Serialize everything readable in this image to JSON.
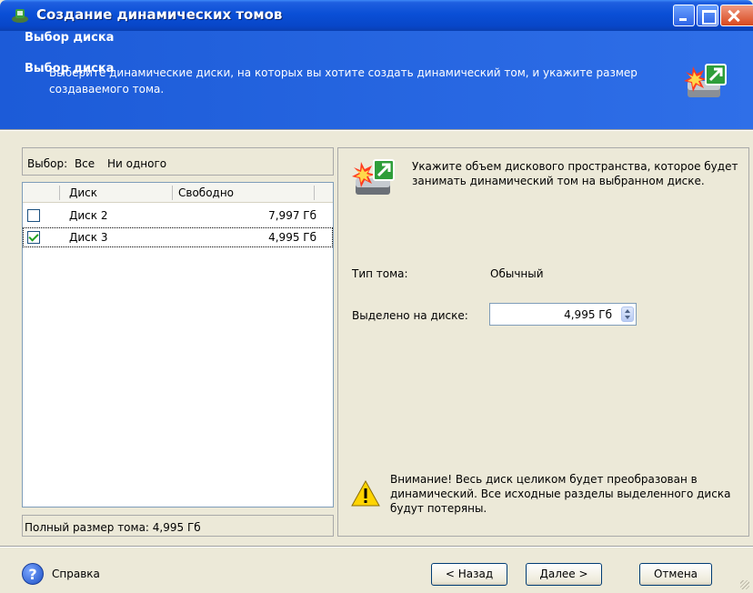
{
  "window": {
    "title": "Создание динамических томов"
  },
  "header": {
    "title": "Выбор диска",
    "description": "Выберите динамические диски, на которых вы хотите создать динамический том, и укажите размер создаваемого тома."
  },
  "selection_bar": {
    "label": "Выбор:",
    "all": "Все",
    "none": "Ни одного"
  },
  "disk_list": {
    "columns": [
      "Диск",
      "Свободно"
    ],
    "rows": [
      {
        "name": "Диск 2",
        "free": "7,997 Гб",
        "checked": false
      },
      {
        "name": "Диск 3",
        "free": "4,995 Гб",
        "checked": true
      }
    ]
  },
  "total": {
    "text": "Полный размер тома: 4,995 Гб"
  },
  "right": {
    "instruction": "Укажите объем дискового пространства, которое будет занимать динамический том на выбранном диске.",
    "volume_type_label": "Тип тома:",
    "volume_type_value": "Обычный",
    "allocated_label": "Выделено на диске:",
    "allocated_value": "4,995 Гб",
    "warning": "Внимание! Весь диск целиком будет преобразован в динамический. Все исходные разделы выделенного диска будут потеряны."
  },
  "footer": {
    "help_label": "Справка",
    "back_label": "< Назад",
    "next_label": "Далее >",
    "cancel_label": "Отмена"
  },
  "colors": {
    "titlebar": "#0a4fd6",
    "header": "#2560e0",
    "face": "#ece9d8"
  }
}
